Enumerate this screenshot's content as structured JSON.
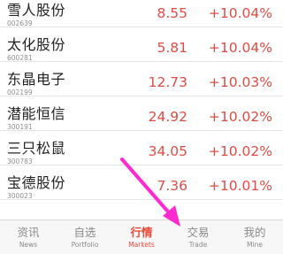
{
  "colors": {
    "up": "#e04b44",
    "active_tab": "#e8493b",
    "arrow": "#ff2bd0"
  },
  "stocks": [
    {
      "name": "雪人股份",
      "code": "002639",
      "price": "8.55",
      "change": "+10.04%"
    },
    {
      "name": "太化股份",
      "code": "600281",
      "price": "5.81",
      "change": "+10.04%"
    },
    {
      "name": "东晶电子",
      "code": "002199",
      "price": "12.73",
      "change": "+10.03%"
    },
    {
      "name": "潜能恒信",
      "code": "300191",
      "price": "24.92",
      "change": "+10.02%"
    },
    {
      "name": "三只松鼠",
      "code": "300783",
      "price": "34.05",
      "change": "+10.02%"
    },
    {
      "name": "宝德股份",
      "code": "300023",
      "price": "7.36",
      "change": "+10.01%"
    },
    {
      "name": "",
      "code": "",
      "price": "",
      "change": ""
    }
  ],
  "tabs": [
    {
      "cn": "资讯",
      "en": "News",
      "active": false
    },
    {
      "cn": "自选",
      "en": "Portfolio",
      "active": false
    },
    {
      "cn": "行情",
      "en": "Markets",
      "active": true
    },
    {
      "cn": "交易",
      "en": "Trade",
      "active": false
    },
    {
      "cn": "我的",
      "en": "Mine",
      "active": false
    }
  ],
  "annotation": {
    "icon": "pointer-arrow-icon"
  }
}
